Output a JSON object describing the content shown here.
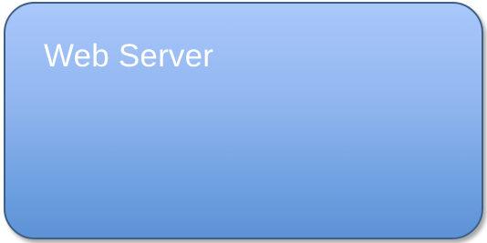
{
  "diagram": {
    "node": {
      "label": "Web Server",
      "fill_top": "#a9c8fb",
      "fill_bottom": "#5d92d6",
      "border_color": "#3f5f86",
      "text_color": "#ffffff"
    }
  }
}
